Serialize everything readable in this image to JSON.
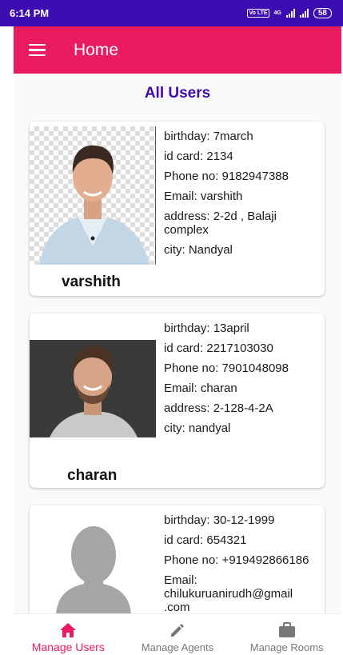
{
  "status_bar": {
    "time": "6:14 PM",
    "lte": "Vo LTE",
    "network": "4G",
    "battery": "58"
  },
  "app_bar": {
    "title": "Home"
  },
  "main": {
    "section_title": "All Users",
    "users": [
      {
        "name": "varshith",
        "birthday": "birthday: 7march",
        "id_card": "id card: 2134",
        "phone": "Phone no: 9182947388",
        "email": "Email: varshith",
        "address": "address: 2-2d , Balaji complex",
        "city": "city: Nandyal"
      },
      {
        "name": "charan",
        "birthday": "birthday: 13april",
        "id_card": "id card: 2217103030",
        "phone": "Phone no: 7901048098",
        "email": "Email: charan",
        "address": "address: 2-128-4-2A",
        "city": "city: nandyal"
      },
      {
        "name": "",
        "birthday": "birthday: 30-12-1999",
        "id_card": "id card: 654321",
        "phone": "Phone no: +919492866186",
        "email": "Email: chilukuruanirudh@gmail .com"
      }
    ]
  },
  "bottom_nav": {
    "items": [
      {
        "label": "Manage Users",
        "icon": "home-icon"
      },
      {
        "label": "Manage Agents",
        "icon": "pencil-icon"
      },
      {
        "label": "Manage Rooms",
        "icon": "briefcase-icon"
      }
    ]
  },
  "colors": {
    "status_bar": "#3d0cb0",
    "app_bar": "#ea1b5e",
    "section_title": "#3d0cb0",
    "active_nav": "#ea1b5e"
  }
}
